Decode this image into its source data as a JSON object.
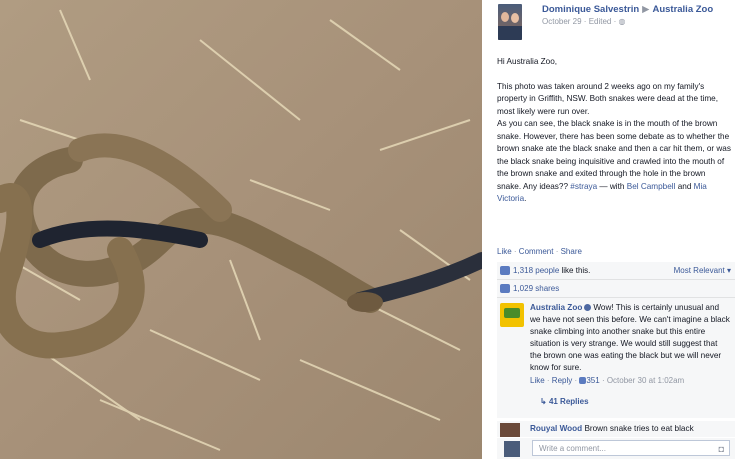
{
  "post": {
    "author": "Dominique Salvestrin",
    "arrow": "▶",
    "target": "Australia Zoo",
    "meta": "October 29 · Edited · ",
    "greeting": "Hi Australia Zoo,",
    "para1": "This photo was taken around 2 weeks ago on my family's property in Griffith, NSW. Both snakes were dead at the time, most likely were run over.",
    "para2": "As you can see, the black snake is in the mouth of the brown snake. However, there has been some debate as to whether the brown snake ate the black snake and then a car hit them, or was the black snake being inquisitive and crawled into the mouth of the brown snake and exited through the hole in the brown snake. Any ideas?? ",
    "hashtag": "#straya",
    "with_text": " — with ",
    "tag1": "Bel Campbell",
    "and_text": " and ",
    "tag2": "Mia Victoria",
    "period": "."
  },
  "actions": {
    "like": "Like",
    "comment": "Comment",
    "share": "Share",
    "sep": " · "
  },
  "stats": {
    "likes_count": "1,318 people",
    "likes_suffix": " like this.",
    "sort": "Most Relevant",
    "shares": "1,029 shares"
  },
  "comments": [
    {
      "author": "Australia Zoo",
      "text": "Wow! This is certainly unusual and we have not seen this before. We can't imagine a black snake climbing into another snake but this entire situation is very strange. We would still suggest that the brown one was eating the black but we will never know for sure.",
      "like": "Like",
      "reply": "Reply",
      "likes": "351",
      "time": "October 30 at 1:02am",
      "replies": "41 Replies"
    },
    {
      "author": "Rouyal Wood",
      "text": "Brown snake tries to eat black"
    }
  ],
  "composer": {
    "placeholder": "Write a comment..."
  },
  "colors": {
    "link": "#3b5998",
    "muted": "#9197a3"
  }
}
